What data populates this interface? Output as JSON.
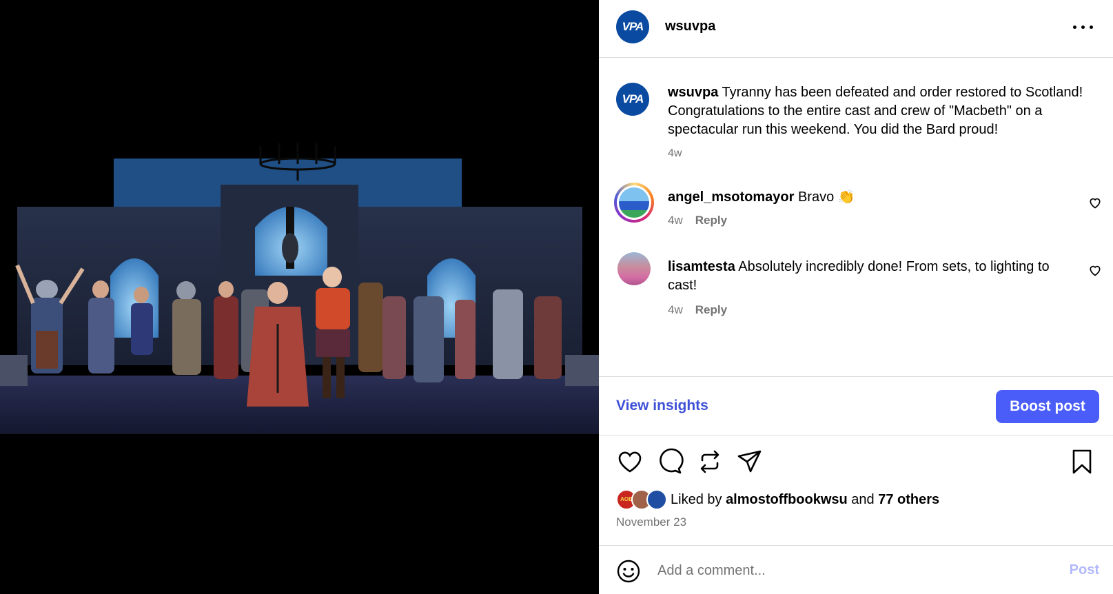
{
  "photo": {
    "description_alt": ""
  },
  "post": {
    "username": "wsuvpa",
    "avatar_text": "VPA",
    "brand_color": "#0a4aa0"
  },
  "caption": {
    "username": "wsuvpa",
    "text": " Tyranny has been defeated and order restored to Scotland! Congratulations to the entire cast and crew of \"Macbeth\" on a spectacular run this weekend. You did the Bard proud!",
    "time": "4w"
  },
  "comments": [
    {
      "username": "angel_msotomayor",
      "text": " Bravo 👏",
      "time": "4w",
      "reply_label": "Reply"
    },
    {
      "username": "lisamtesta",
      "text": " Absolutely incredibly done! From sets, to lighting to cast!",
      "time": "4w",
      "reply_label": "Reply"
    }
  ],
  "insights": {
    "view_label": "View insights",
    "boost_label": "Boost post",
    "accent_color": "#4a5df9"
  },
  "likes": {
    "prefix": "Liked by ",
    "first_user": "almostoffbookwsu",
    "middle": " and ",
    "others": "77 others",
    "avatar_labels": [
      "AOB"
    ]
  },
  "date": "November 23",
  "comment_box": {
    "placeholder": "Add a comment...",
    "post_label": "Post"
  }
}
